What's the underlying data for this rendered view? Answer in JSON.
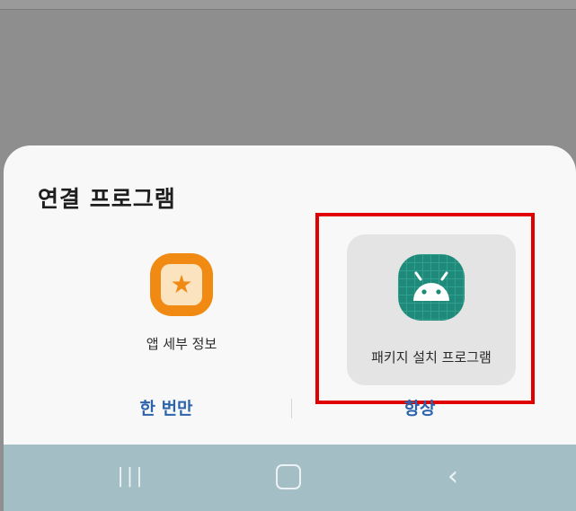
{
  "dialog": {
    "title": "연결 프로그램",
    "apps": [
      {
        "label": "앱 세부 정보",
        "icon": "app-details-icon"
      },
      {
        "label": "패키지 설치 프로그램",
        "icon": "android-icon"
      }
    ],
    "actions": {
      "once": "한 번만",
      "always": "항상"
    }
  },
  "navbar": {
    "recent": "|||",
    "back": "‹"
  },
  "colors": {
    "highlight": "#e00000",
    "action_text": "#2c63ad",
    "navbar": "#a3bec5",
    "app_details_icon": "#f08a12",
    "android_icon": "#1f8a7a"
  }
}
